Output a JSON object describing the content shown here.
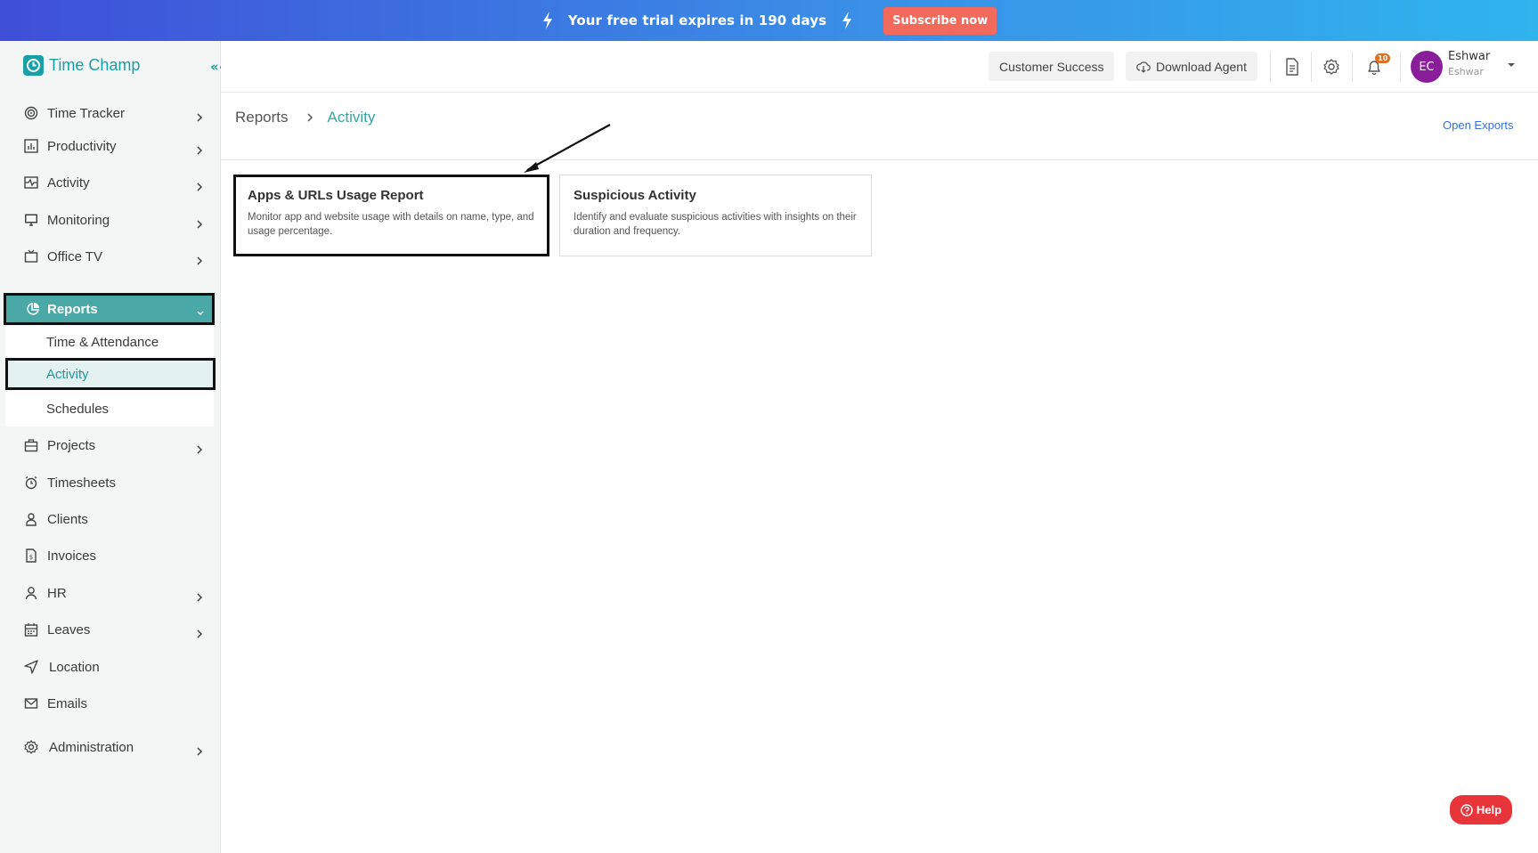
{
  "banner": {
    "message": "Your free trial expires in 190 days",
    "subscribe_label": "Subscribe now"
  },
  "brand": {
    "name": "Time Champ",
    "color": "#18a0a6"
  },
  "header": {
    "customer_success_label": "Customer Success",
    "download_agent_label": "Download Agent",
    "notification_count": "10",
    "user": {
      "initials": "EC",
      "name": "Eshwar",
      "subtitle": "Eshwar"
    }
  },
  "sidebar": {
    "items": [
      {
        "label": "Time Tracker",
        "icon": "target-icon"
      },
      {
        "label": "Productivity",
        "icon": "bar-chart-icon"
      },
      {
        "label": "Activity",
        "icon": "activity-icon"
      },
      {
        "label": "Monitoring",
        "icon": "monitor-icon"
      },
      {
        "label": "Office TV",
        "icon": "tv-icon"
      },
      {
        "label": "Reports",
        "icon": "pie-chart-icon"
      },
      {
        "label": "Projects",
        "icon": "briefcase-icon"
      },
      {
        "label": "Timesheets",
        "icon": "alarm-clock-icon"
      },
      {
        "label": "Clients",
        "icon": "person-icon"
      },
      {
        "label": "Invoices",
        "icon": "invoice-icon"
      },
      {
        "label": "HR",
        "icon": "user-icon"
      },
      {
        "label": "Leaves",
        "icon": "calendar-icon"
      },
      {
        "label": "Location",
        "icon": "location-arrow-icon"
      },
      {
        "label": "Emails",
        "icon": "mail-icon"
      },
      {
        "label": "Administration",
        "icon": "gear-icon"
      }
    ],
    "reports_submenu": [
      "Time & Attendance",
      "Activity",
      "Schedules"
    ]
  },
  "breadcrumb": {
    "root": "Reports",
    "current": "Activity"
  },
  "open_exports_label": "Open Exports",
  "cards": [
    {
      "title": "Apps & URLs Usage Report",
      "description": "Monitor app and website usage with details on name, type, and usage percentage."
    },
    {
      "title": "Suspicious Activity",
      "description": "Identify and evaluate suspicious activities with insights on their duration and frequency."
    }
  ],
  "help_label": "Help",
  "colors": {
    "accent": "#4aa9a6",
    "help": "#e8353a",
    "banner_button": "#f26a5b"
  }
}
